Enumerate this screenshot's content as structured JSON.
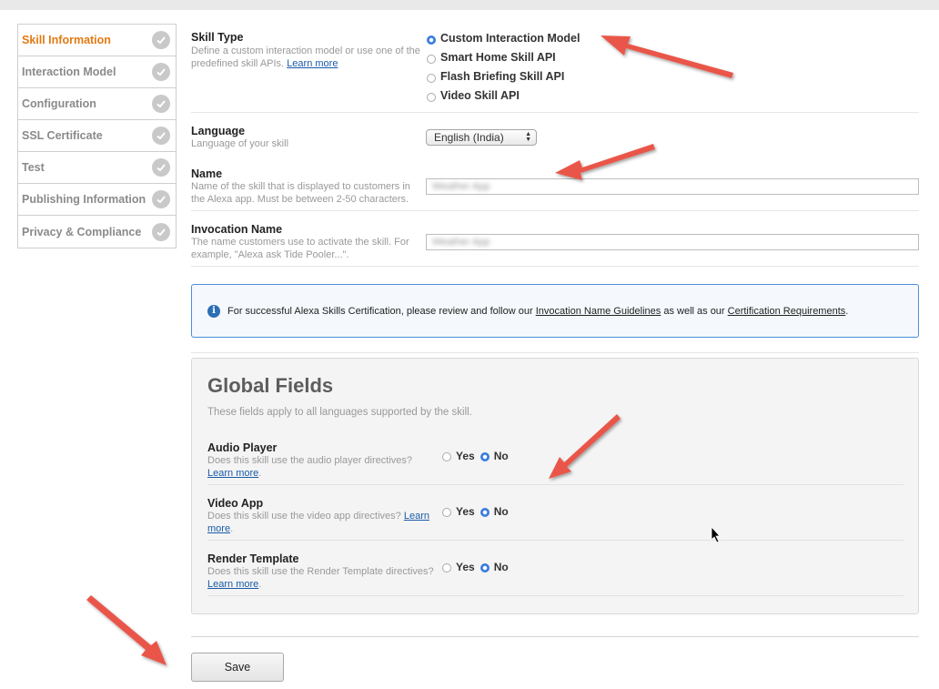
{
  "sidebar": {
    "items": [
      {
        "label": "Skill Information",
        "active": true
      },
      {
        "label": "Interaction Model"
      },
      {
        "label": "Configuration"
      },
      {
        "label": "SSL Certificate"
      },
      {
        "label": "Test"
      },
      {
        "label": "Publishing Information"
      },
      {
        "label": "Privacy & Compliance"
      }
    ]
  },
  "skill_type": {
    "label": "Skill Type",
    "desc": "Define a custom interaction model or use one of the predefined skill APIs.",
    "learn_more": "Learn more",
    "options": [
      "Custom Interaction Model",
      "Smart Home Skill API",
      "Flash Briefing Skill API",
      "Video Skill API"
    ],
    "selected": "Custom Interaction Model"
  },
  "language": {
    "label": "Language",
    "desc": "Language of your skill",
    "value": "English (India)"
  },
  "name": {
    "label": "Name",
    "desc": "Name of the skill that is displayed to customers in the Alexa app. Must be between 2-50 characters.",
    "value": "Weather App"
  },
  "invocation": {
    "label": "Invocation Name",
    "desc": "The name customers use to activate the skill. For example, \"Alexa ask Tide Pooler...\".",
    "value": "Weather App"
  },
  "info": {
    "text_before": "For successful Alexa Skills Certification, please review and follow our ",
    "link1": "Invocation Name Guidelines",
    "text_mid": " as well as our ",
    "link2": "Certification Requirements",
    "text_after": "."
  },
  "global": {
    "title": "Global Fields",
    "subtitle": "These fields apply to all languages supported by the skill.",
    "yes_label": "Yes",
    "no_label": "No",
    "audio": {
      "label": "Audio Player",
      "desc": "Does this skill use the audio player directives?",
      "learn_more": "Learn more",
      "value": "No"
    },
    "video": {
      "label": "Video App",
      "desc": "Does this skill use the video app directives?",
      "learn_more_a": "Learn",
      "learn_more_b": "more",
      "value": "No"
    },
    "render": {
      "label": "Render Template",
      "desc": "Does this skill use the Render Template directives?",
      "learn_more": "Learn more",
      "value": "No"
    }
  },
  "save_label": "Save",
  "colors": {
    "accent_active": "#e47911",
    "link": "#1a5aa7",
    "arrow": "#e9574a",
    "info_border": "#4a90d9"
  }
}
